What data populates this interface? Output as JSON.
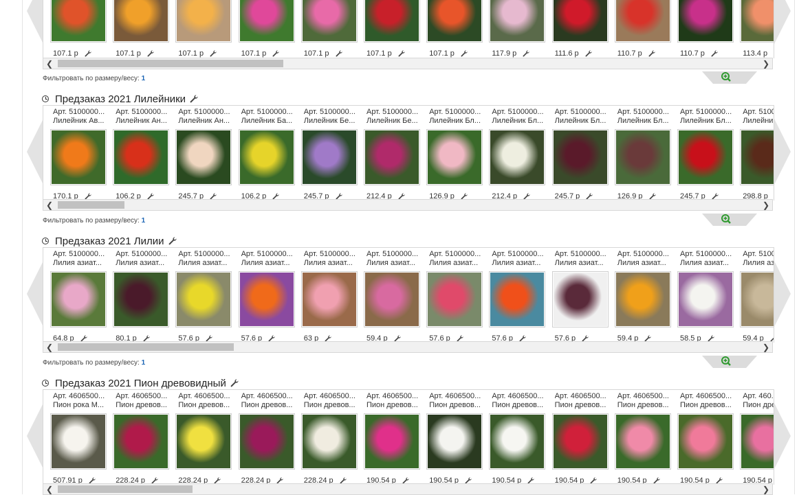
{
  "sections": [
    {
      "title": "",
      "filter_label": "Фильтровать по размеру/весу:",
      "filter_value": "1",
      "items": [
        {
          "art": "",
          "name": "",
          "price": "107.1 р",
          "c1": "#e0532a",
          "c2": "#3f7a2e"
        },
        {
          "art": "",
          "name": "",
          "price": "107.1 р",
          "c1": "#f0a02a",
          "c2": "#7a5a3a"
        },
        {
          "art": "",
          "name": "",
          "price": "107.1 р",
          "c1": "#f3b14a",
          "c2": "#b89a7a"
        },
        {
          "art": "",
          "name": "",
          "price": "107.1 р",
          "c1": "#e0489a",
          "c2": "#3f7a2e"
        },
        {
          "art": "",
          "name": "",
          "price": "107.1 р",
          "c1": "#e86aa8",
          "c2": "#4f6a3a"
        },
        {
          "art": "",
          "name": "",
          "price": "107.1 р",
          "c1": "#c8202a",
          "c2": "#2f5a2a"
        },
        {
          "art": "",
          "name": "",
          "price": "107.1 р",
          "c1": "#e8552a",
          "c2": "#2c4a25"
        },
        {
          "art": "",
          "name": "",
          "price": "117.9 р",
          "c1": "#e6b9cf",
          "c2": "#5a6a4a"
        },
        {
          "art": "",
          "name": "",
          "price": "111.6 р",
          "c1": "#d01a2a",
          "c2": "#2a3a20"
        },
        {
          "art": "",
          "name": "",
          "price": "110.7 р",
          "c1": "#d8332a",
          "c2": "#9a7a5a"
        },
        {
          "art": "",
          "name": "",
          "price": "110.7 р",
          "c1": "#c8308a",
          "c2": "#1f3a18"
        },
        {
          "art": "",
          "name": "",
          "price": "113.4 р",
          "c1": "#f0906a",
          "c2": "#5a6a3a"
        }
      ]
    },
    {
      "title": "Предзаказ 2021 Лилейники",
      "filter_label": "Фильтровать по размеру/весу:",
      "filter_value": "1",
      "items": [
        {
          "art": "Арт. 5100000...",
          "name": "Лилейник Ав...",
          "price": "170.1 р",
          "c1": "#f07a1a",
          "c2": "#3f6a2a"
        },
        {
          "art": "Арт. 5100000...",
          "name": "Лилейник Ан...",
          "price": "106.2 р",
          "c1": "#d8301a",
          "c2": "#2f6a2a"
        },
        {
          "art": "Арт. 5100000...",
          "name": "Лилейник Ан...",
          "price": "245.7 р",
          "c1": "#f0d6c0",
          "c2": "#2a4a20"
        },
        {
          "art": "Арт. 5100000...",
          "name": "Лилейник Ба...",
          "price": "106.2 р",
          "c1": "#e6d42a",
          "c2": "#3a6a2a"
        },
        {
          "art": "Арт. 5100000...",
          "name": "Лилейник Бе...",
          "price": "245.7 р",
          "c1": "#a07ac8",
          "c2": "#2a4a2a"
        },
        {
          "art": "Арт. 5100000...",
          "name": "Лилейник Бе...",
          "price": "212.4 р",
          "c1": "#b02a6a",
          "c2": "#3a5a2a"
        },
        {
          "art": "Арт. 5100000...",
          "name": "Лилейник Бл...",
          "price": "126.9 р",
          "c1": "#f0b8c4",
          "c2": "#3a6a2a"
        },
        {
          "art": "Арт. 5100000...",
          "name": "Лилейник Бл...",
          "price": "212.4 р",
          "c1": "#eeeee0",
          "c2": "#3a4a2a"
        },
        {
          "art": "Арт. 5100000...",
          "name": "Лилейник Бл...",
          "price": "245.7 р",
          "c1": "#5a1a2a",
          "c2": "#3a4a2a"
        },
        {
          "art": "Арт. 5100000...",
          "name": "Лилейник Бл...",
          "price": "126.9 р",
          "c1": "#6a3a3a",
          "c2": "#4a6a3a"
        },
        {
          "art": "Арт. 5100000...",
          "name": "Лилейник Бл...",
          "price": "245.7 р",
          "c1": "#c8101a",
          "c2": "#3a6a2a"
        },
        {
          "art": "Арт. 5100000...",
          "name": "Лилейник Бл...",
          "price": "298.8 р",
          "c1": "#5a2a1a",
          "c2": "#3a5a2a"
        }
      ]
    },
    {
      "title": "Предзаказ 2021 Лилии",
      "filter_label": "Фильтровать по размеру/весу:",
      "filter_value": "1",
      "items": [
        {
          "art": "Арт. 5100000...",
          "name": "Лилия азиат...",
          "price": "64.8 р",
          "c1": "#e8a8c8",
          "c2": "#5a7a3a"
        },
        {
          "art": "Арт. 5100000...",
          "name": "Лилия азиат...",
          "price": "80.1 р",
          "c1": "#4a1a2a",
          "c2": "#3a5a2a"
        },
        {
          "art": "Арт. 5100000...",
          "name": "Лилия азиат...",
          "price": "57.6 р",
          "c1": "#e8d82a",
          "c2": "#8a8a6a"
        },
        {
          "art": "Арт. 5100000...",
          "name": "Лилия азиат...",
          "price": "57.6 р",
          "c1": "#f06a1a",
          "c2": "#8a4aa0"
        },
        {
          "art": "Арт. 5100000...",
          "name": "Лилия азиат...",
          "price": "63 р",
          "c1": "#f0a0b0",
          "c2": "#9a6a4a"
        },
        {
          "art": "Арт. 5100000...",
          "name": "Лилия азиат...",
          "price": "59.4 р",
          "c1": "#d86aa0",
          "c2": "#8a6a4a"
        },
        {
          "art": "Арт. 5100000...",
          "name": "Лилия азиат...",
          "price": "57.6 р",
          "c1": "#e04a6a",
          "c2": "#7a8a6a"
        },
        {
          "art": "Арт. 5100000...",
          "name": "Лилия азиат...",
          "price": "57.6 р",
          "c1": "#f0501a",
          "c2": "#4a8aa0"
        },
        {
          "art": "Арт. 5100000...",
          "name": "Лилия азиат...",
          "price": "57.6 р",
          "c1": "#5a2a3a",
          "c2": "#f0f0f0"
        },
        {
          "art": "Арт. 5100000...",
          "name": "Лилия азиат...",
          "price": "59.4 р",
          "c1": "#f0a01a",
          "c2": "#8a7a5a"
        },
        {
          "art": "Арт. 5100000...",
          "name": "Лилия азиат...",
          "price": "58.5 р",
          "c1": "#f4f4f0",
          "c2": "#9a6aa0"
        },
        {
          "art": "Арт. 5100000...",
          "name": "Лилия аз...",
          "price": "59.4 р",
          "c1": "#c8b89a",
          "c2": "#9a8a6a"
        }
      ]
    },
    {
      "title": "Предзаказ 2021 Пион древовидный",
      "filter_label": "",
      "filter_value": "",
      "items": [
        {
          "art": "Арт. 4606500...",
          "name": "Пион рока М...",
          "price": "507.91 р",
          "c1": "#f6f4ee",
          "c2": "#5a5a4a"
        },
        {
          "art": "Арт. 4606500...",
          "name": "Пион древов...",
          "price": "228.24 р",
          "c1": "#b01a4a",
          "c2": "#3a6a2a"
        },
        {
          "art": "Арт. 4606500...",
          "name": "Пион древов...",
          "price": "228.24 р",
          "c1": "#f0e040",
          "c2": "#3a5a2a"
        },
        {
          "art": "Арт. 4606500...",
          "name": "Пион древов...",
          "price": "228.24 р",
          "c1": "#9a1a5a",
          "c2": "#3a5a2a"
        },
        {
          "art": "Арт. 4606500...",
          "name": "Пион древов...",
          "price": "228.24 р",
          "c1": "#f0ece0",
          "c2": "#3a5a2a"
        },
        {
          "art": "Арт. 4606500...",
          "name": "Пион древов...",
          "price": "190.54 р",
          "c1": "#e0308a",
          "c2": "#3a6a2a"
        },
        {
          "art": "Арт. 4606500...",
          "name": "Пион древов...",
          "price": "190.54 р",
          "c1": "#f4f4f0",
          "c2": "#2a3a20"
        },
        {
          "art": "Арт. 4606500...",
          "name": "Пион древов...",
          "price": "190.54 р",
          "c1": "#f6f6f2",
          "c2": "#3a5a2a"
        },
        {
          "art": "Арт. 4606500...",
          "name": "Пион древов...",
          "price": "190.54 р",
          "c1": "#d0203a",
          "c2": "#3a5a2a"
        },
        {
          "art": "Арт. 4606500...",
          "name": "Пион древов...",
          "price": "190.54 р",
          "c1": "#f08aa8",
          "c2": "#3a6a2a"
        },
        {
          "art": "Арт. 4606500...",
          "name": "Пион древов...",
          "price": "190.54 р",
          "c1": "#f07a9a",
          "c2": "#4a6a2a"
        },
        {
          "art": "Арт. 460...",
          "name": "Пион древ...",
          "price": "190.54 р",
          "c1": "#e870a0",
          "c2": "#3a6a2a"
        }
      ]
    }
  ],
  "colors": {
    "zoom_green": "#2f9a2f",
    "arrow_gray": "#e0e0e0",
    "tab_gray": "#dcdcdc",
    "link_blue": "#1a64b4"
  }
}
